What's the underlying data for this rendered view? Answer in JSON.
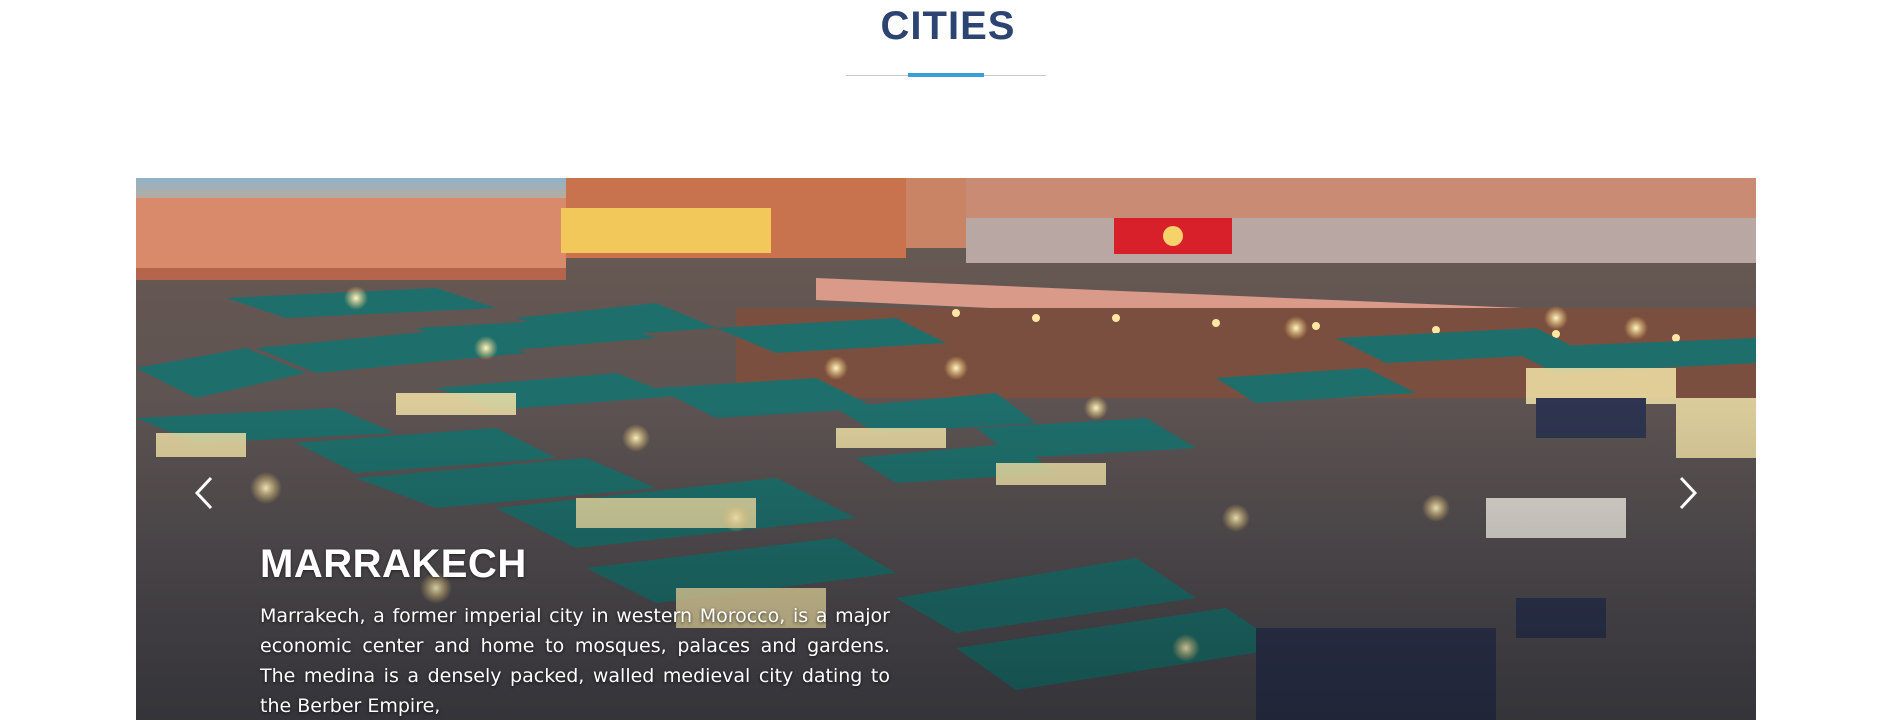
{
  "section": {
    "title": "CITIES",
    "accent_color": "#3a9ed9",
    "title_color": "#2d4472"
  },
  "slider": {
    "prev_icon": "chevron-left-icon",
    "next_icon": "chevron-right-icon",
    "slide": {
      "image": "night-market-square-photo",
      "title": "MARRAKECH",
      "description": "Marrakech, a former imperial city in western Morocco, is a major economic center and home to mosques, palaces and gardens. The medina is a densely packed, walled medieval city dating to the Berber Empire,"
    }
  }
}
